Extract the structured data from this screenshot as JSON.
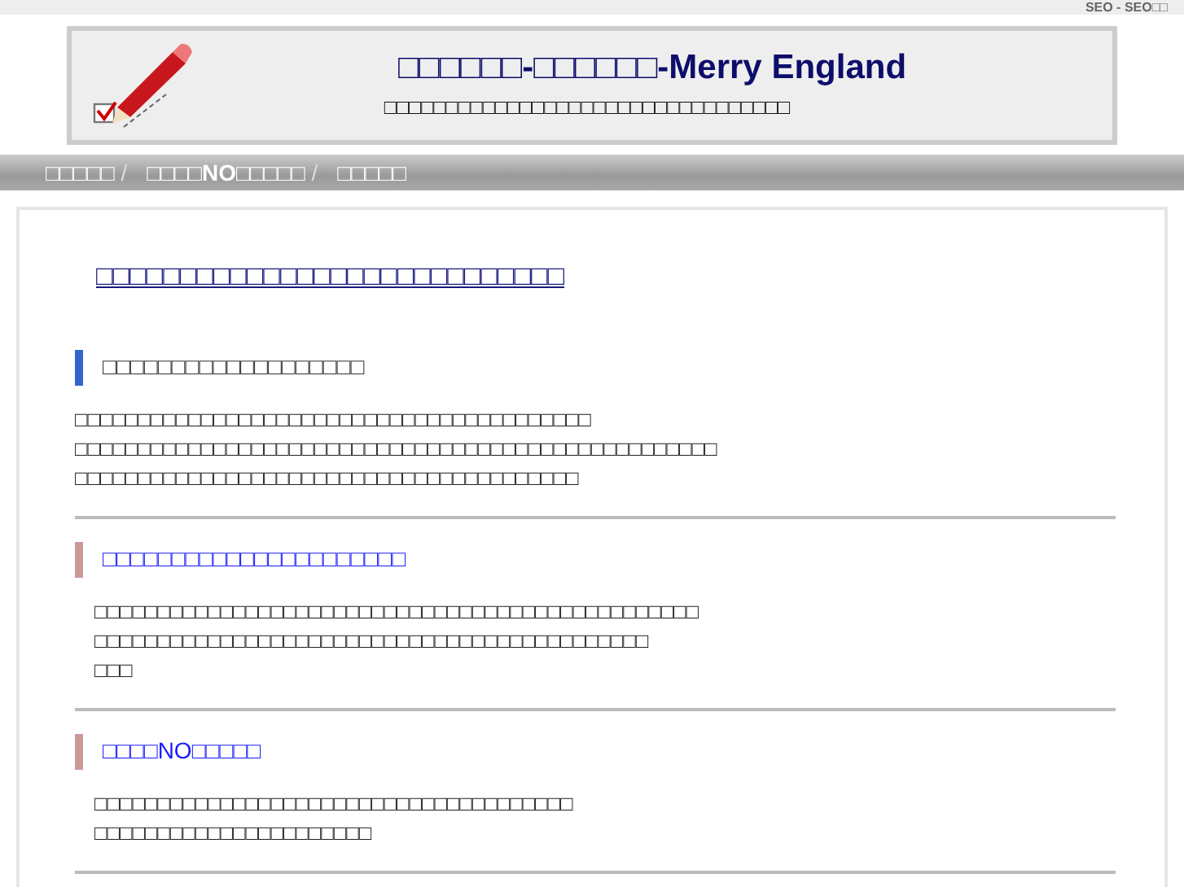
{
  "top_bar": {
    "text": "SEO - SEO□□"
  },
  "header": {
    "title": "□□□□□□-□□□□□□-Merry England",
    "subtitle": "□□□□□□□□□□□□□□□□□□□□□□□□□□□□□□□□□"
  },
  "nav": [
    {
      "label": "□□□□□",
      "separator": "/"
    },
    {
      "label": "□□□□NO□□□□□",
      "separator": "/"
    },
    {
      "label": "□□□□□"
    }
  ],
  "main": {
    "title": "□□□□□□□□□□□□□□□□□□□□□□□□□□□□",
    "sections": [
      {
        "kind": "plain",
        "heading": "□□□□□□□□□□□□□□□□□□□",
        "lines": [
          "□□□□□□□□□□□□□□□□□□□□□□□□□□□□□□□□□□□□□□□□□ □□□□□□□□□□□□□□□□□□□□□□□□□□□□□□□□□□□□□□□□□□□□□□□□□□□",
          "□□□□□□□□□□□□□□□□□□□□□□□□□□□□□□□□□□□□□□□□"
        ]
      },
      {
        "kind": "link",
        "heading": "□□□□□□□□□□□□□□□□□□□□□□",
        "lines": [
          "□□□□□□□□□□□□□□□□□□□□□□□□□□□□□□□□□□□□□□□□□□□□□□□□",
          "□□□□□□□□□□□□□□□□□□□□□□□□□□□□□□□□□□□□□□□□□□□□",
          "□□□"
        ]
      },
      {
        "kind": "link",
        "heading": "□□□□NO□□□□□",
        "lines": [
          "□□□□□□□□□□□□□□□□□□□□□□□□□□□□□□□□□□□□□□",
          "□□□□□□□□□□□□□□□□□□□□□□"
        ]
      }
    ]
  }
}
